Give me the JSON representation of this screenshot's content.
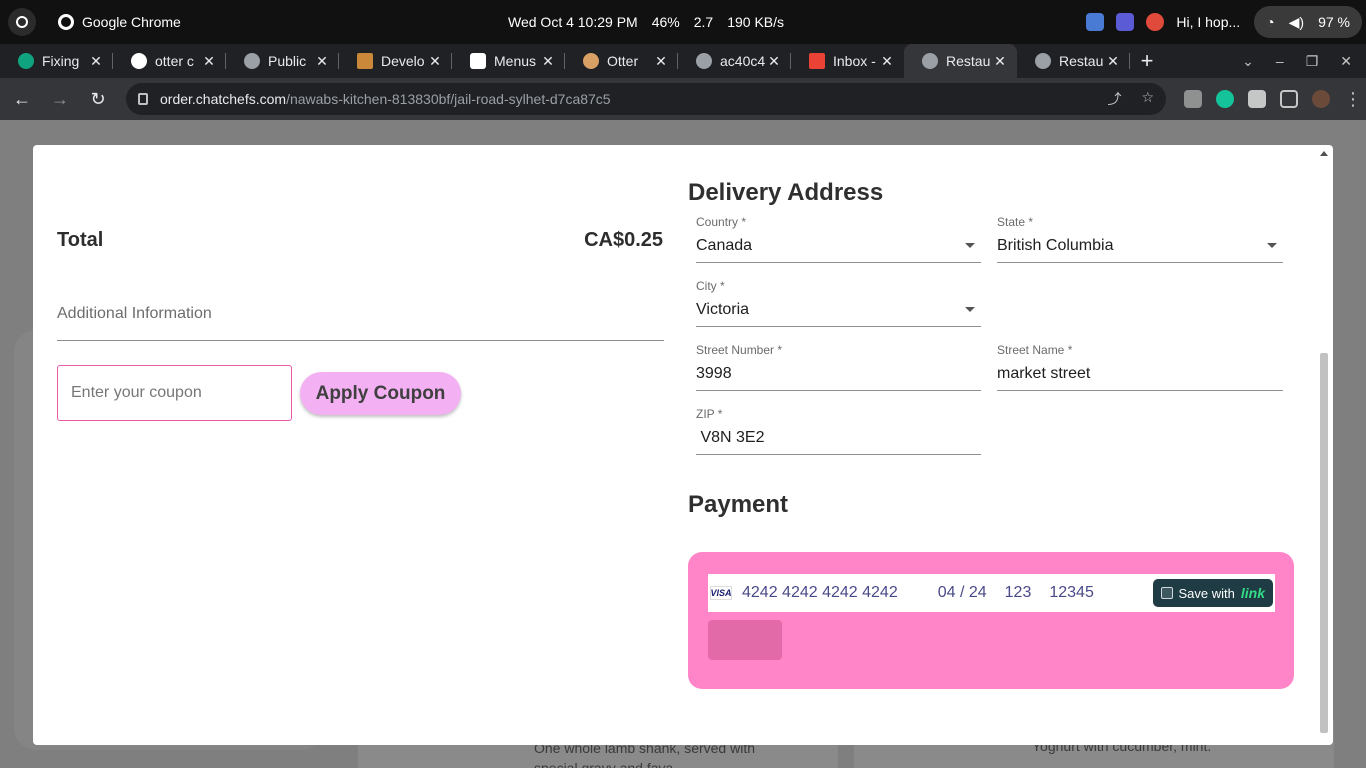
{
  "os": {
    "app_name": "Google Chrome",
    "datetime": "Wed Oct 4  10:29 PM",
    "cpu": "46%",
    "load": "2.7",
    "net": "190 KB/s",
    "notification": "Hi, I hop...",
    "battery": "97 %"
  },
  "tabs": [
    {
      "title": "Fixing"
    },
    {
      "title": "otter c"
    },
    {
      "title": "Public"
    },
    {
      "title": "Develo"
    },
    {
      "title": "Menus"
    },
    {
      "title": "Otter"
    },
    {
      "title": "ac40c4"
    },
    {
      "title": "Inbox -"
    },
    {
      "title": "Restau"
    },
    {
      "title": "Restau"
    }
  ],
  "toolbar": {
    "url_host": "order.chatchefs.com",
    "url_path": "/nawabs-kitchen-813830bf/jail-road-sylhet-d7ca87c5"
  },
  "order": {
    "total_label": "Total",
    "total_value": "CA$0.25",
    "additional_info_label": "Additional Information",
    "coupon_placeholder": "Enter your coupon",
    "apply_coupon_label": "Apply Coupon"
  },
  "delivery": {
    "title": "Delivery Address",
    "country_label": "Country *",
    "country_value": "Canada",
    "state_label": "State *",
    "state_value": "British Columbia",
    "city_label": "City *",
    "city_value": "Victoria",
    "street_number_label": "Street Number *",
    "street_number_value": "3998",
    "street_name_label": "Street Name *",
    "street_name_value": "market street",
    "zip_label": "ZIP *",
    "zip_value": " V8N 3E2"
  },
  "payment": {
    "title": "Payment",
    "card_brand": "VISA",
    "card_number": "4242 4242 4242 4242",
    "expiry": "04 / 24",
    "cvc": "123",
    "postal": "12345",
    "save_with": "Save with",
    "link_brand": "link"
  },
  "background_text": {
    "dish1": "One whole lamb shank, served with special gravy and fava",
    "dish2": "Yoghurt with cucumber, mint."
  }
}
